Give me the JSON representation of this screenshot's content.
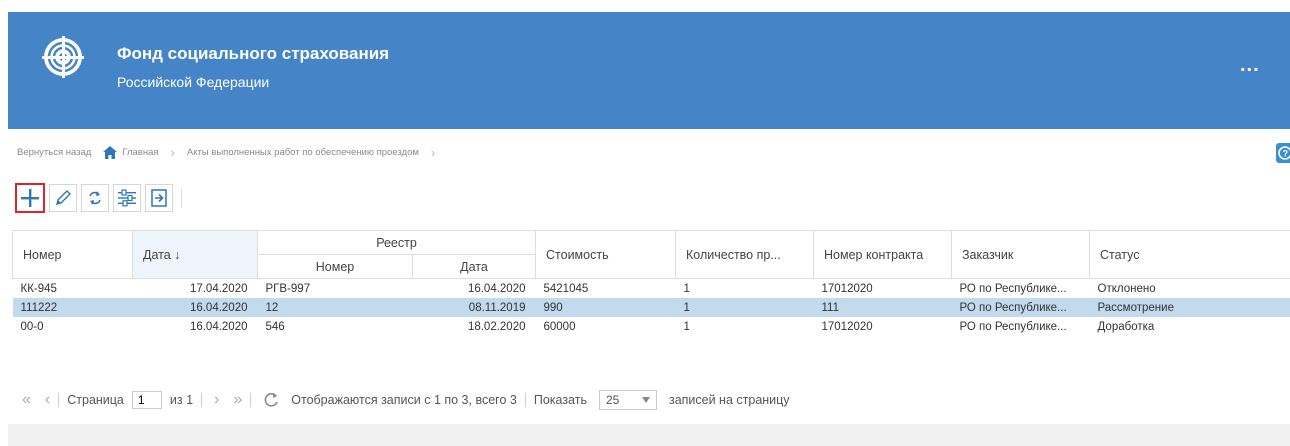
{
  "header": {
    "title": "Фонд социального страхования",
    "subtitle": "Российской Федерации",
    "menu_label": "..."
  },
  "breadcrumb": {
    "back": "Вернуться назад",
    "home": "Главная",
    "current": "Акты выполненных работ по обеспечению проездом"
  },
  "toolbar": [
    "plus-icon",
    "pencil-icon",
    "refresh-icon",
    "filter-settings-icon",
    "export-icon"
  ],
  "table": {
    "headers": {
      "number": "Номер",
      "date": "Дата",
      "sort_arrow": "↓",
      "registry": "Реестр",
      "registry_number": "Номер",
      "registry_date": "Дата",
      "cost": "Стоимость",
      "quantity": "Количество пр...",
      "contract": "Номер контракта",
      "customer": "Заказчик",
      "status": "Статус"
    },
    "rows": [
      {
        "number": "КК-945",
        "date": "17.04.2020",
        "reg_number": "РГВ-997",
        "reg_date": "16.04.2020",
        "cost": "5421045",
        "quantity": "1",
        "contract": "17012020",
        "customer": "РО по Республике...",
        "status": "Отклонено"
      },
      {
        "number": "111222",
        "date": "16.04.2020",
        "reg_number": "12",
        "reg_date": "08.11.2019",
        "cost": "990",
        "quantity": "1",
        "contract": "111",
        "customer": "РО по Республике...",
        "status": "Рассмотрение"
      },
      {
        "number": "00-0",
        "date": "16.04.2020",
        "reg_number": "546",
        "reg_date": "18.02.2020",
        "cost": "60000",
        "quantity": "1",
        "contract": "17012020",
        "customer": "РО по Республике...",
        "status": "Доработка"
      }
    ]
  },
  "pager": {
    "page_label": "Страница",
    "page_value": "1",
    "of_label": "из 1",
    "info": "Отображаются записи с 1 по 3, всего 3",
    "show_label": "Показать",
    "page_size": "25",
    "per_page_label": "записей на страницу"
  },
  "colors": {
    "header": "#4584c6",
    "selected_row": "#c2d9ee",
    "active_border": "#d9262c"
  }
}
